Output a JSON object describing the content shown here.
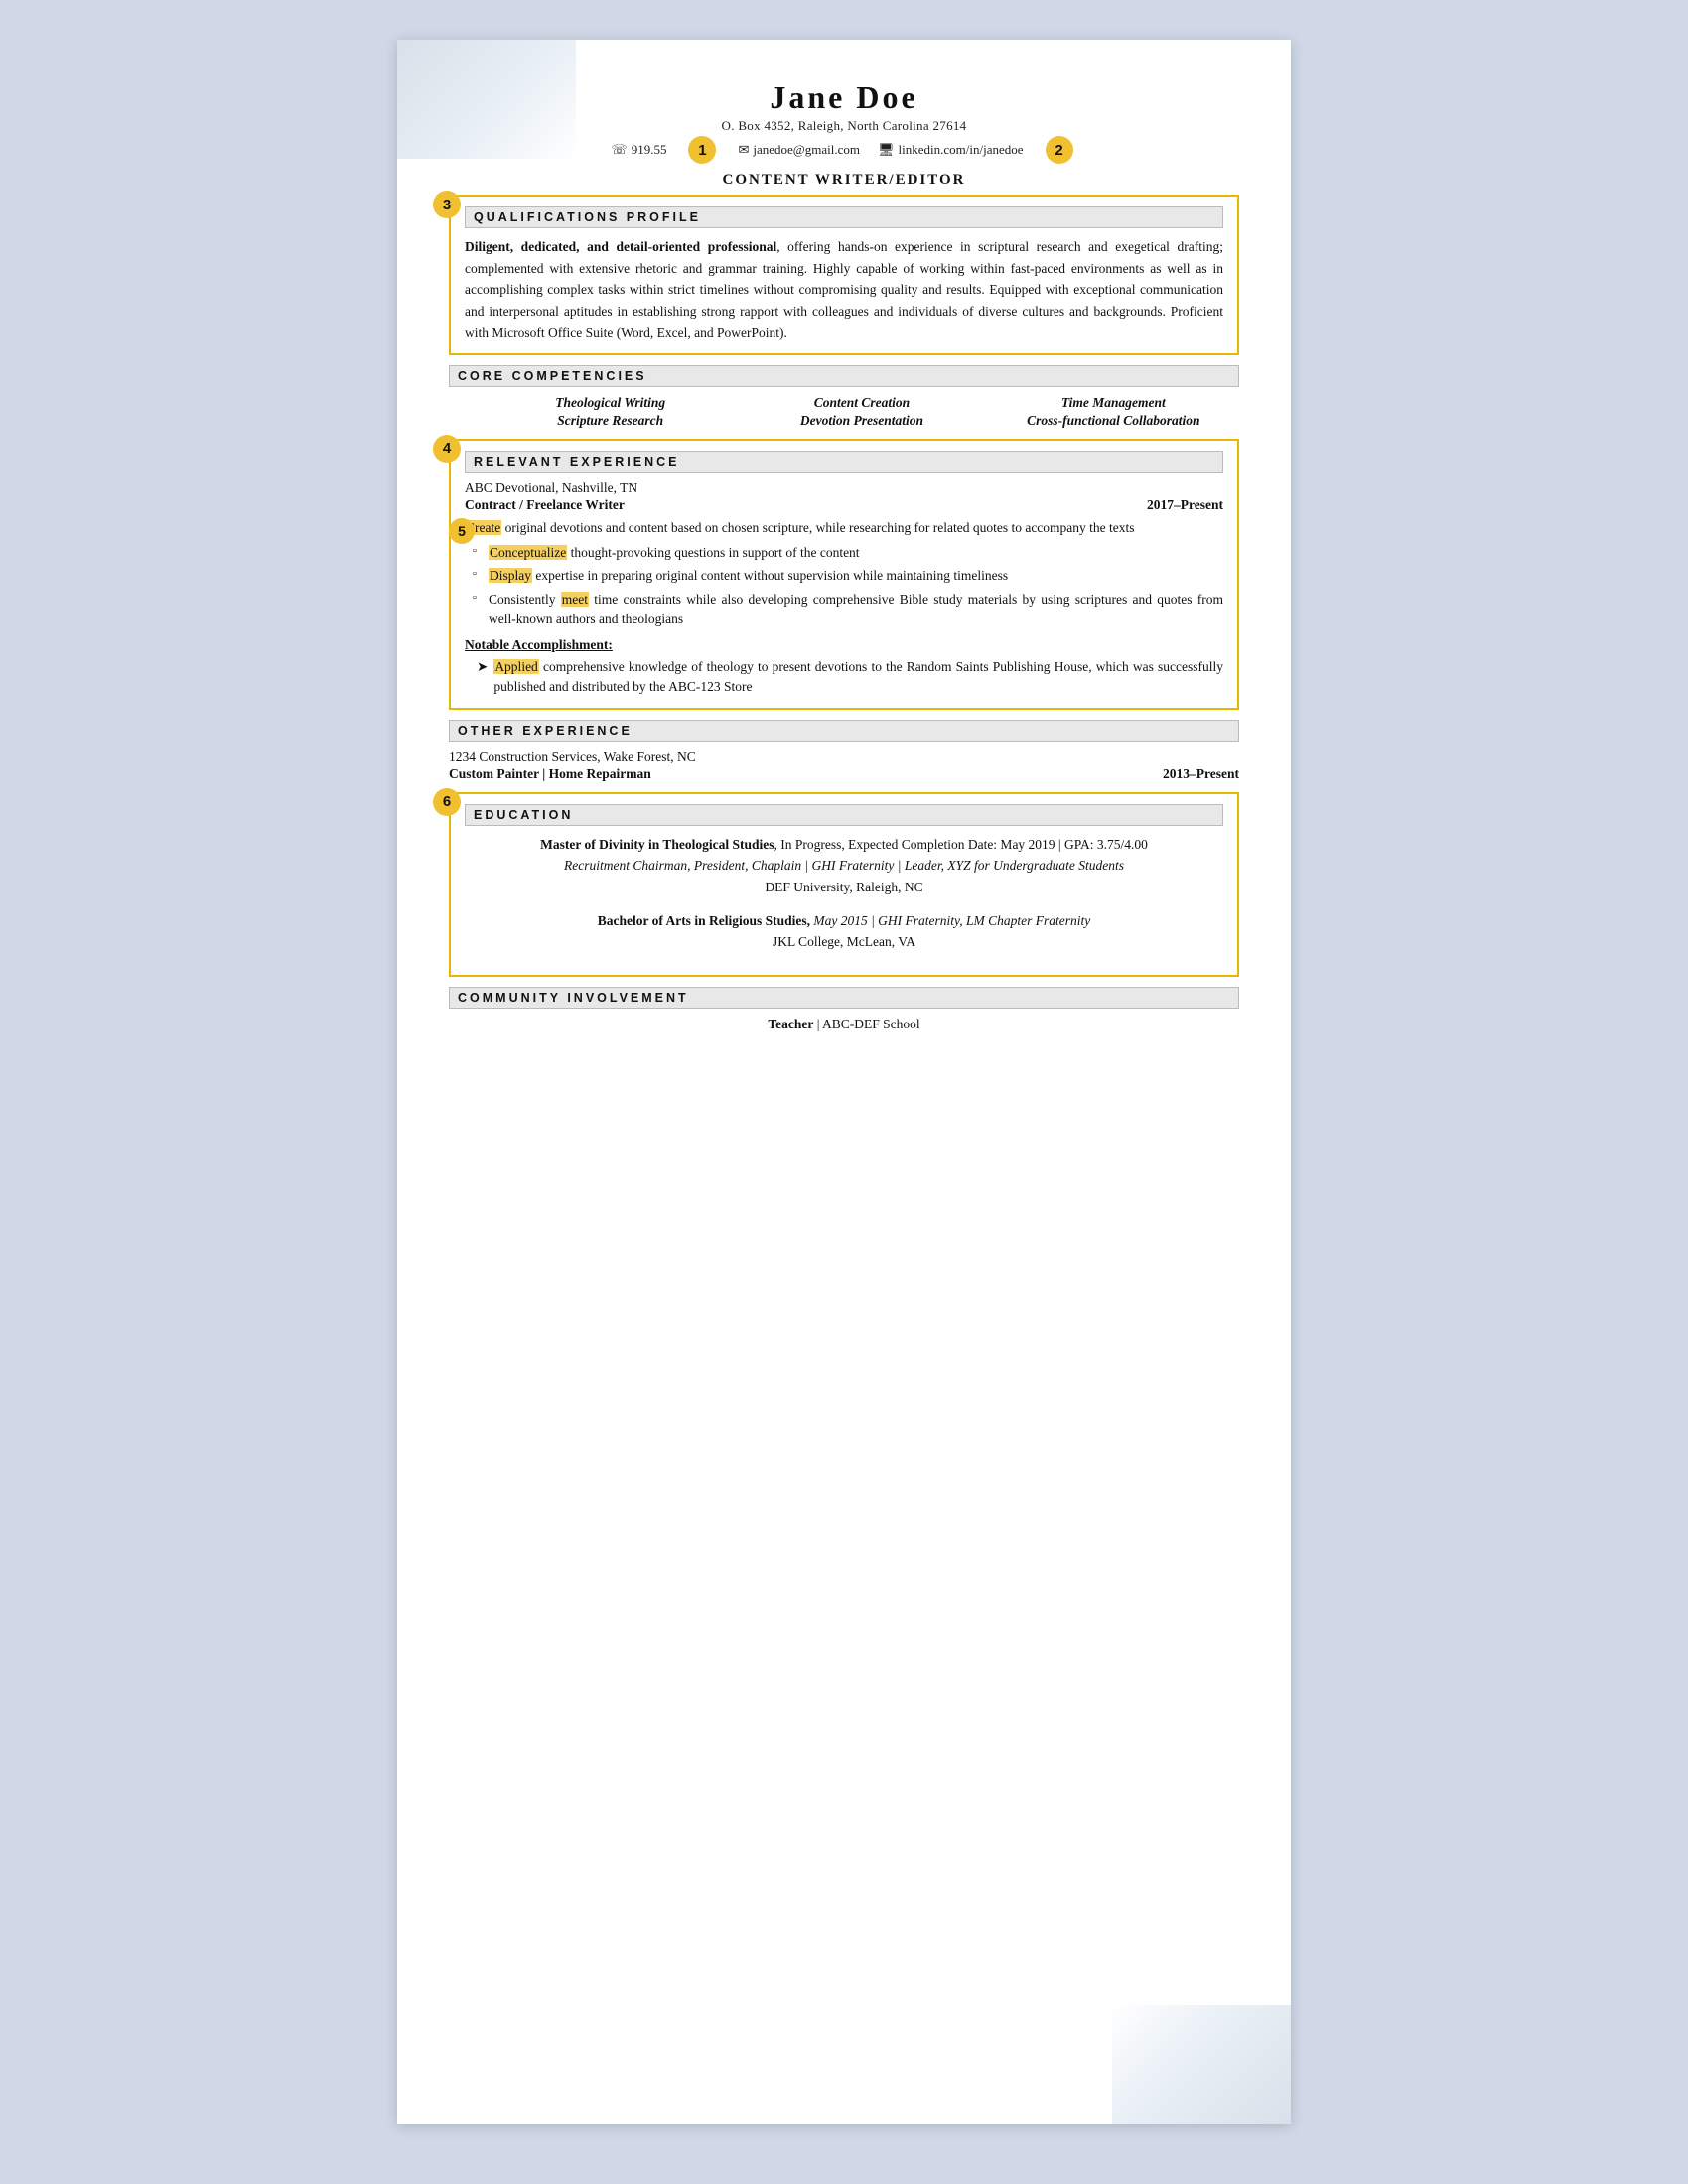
{
  "header": {
    "name": "Jane Doe",
    "address": "O. Box 4352, Raleigh, North Carolina 27614",
    "phone_icon": "☏",
    "phone": "919.55",
    "email_icon": "✉",
    "email": "janedoe@gmail.com",
    "linkedin_icon": "🖥",
    "linkedin": "linkedin.com/in/janedoe",
    "job_title": "Content Writer/Editor"
  },
  "sections": {
    "qualifications_header": "Qualifications Profile",
    "qualifications_text": "Diligent, dedicated, and detail-oriented professional, offering hands-on experience in scriptural research and exegetical drafting; complemented with extensive rhetoric and grammar training. Highly capable of working within fast-paced environments as well as in accomplishing complex tasks within strict timelines without compromising quality and results. Equipped with exceptional communication and interpersonal aptitudes in establishing strong rapport with colleagues and individuals of diverse cultures and backgrounds. Proficient with Microsoft Office Suite (Word, Excel, and PowerPoint).",
    "qualifications_bold": "Diligent, dedicated, and detail-oriented professional",
    "core_header": "Core Competencies",
    "competencies": [
      "Theological Writing",
      "Content Creation",
      "Time Management",
      "Scripture Research",
      "Devotion Presentation",
      "Cross-functional Collaboration"
    ],
    "relevant_header": "Relevant Experience",
    "relevant_company": "ABC Devotional, Nashville, TN",
    "relevant_title": "Contract / Freelance Writer",
    "relevant_dates": "2017–Present",
    "relevant_bullet0": "Create original devotions and content based on chosen scripture, while researching for related quotes to accompany the texts",
    "relevant_bullets": [
      "Conceptualize thought-provoking questions in support of the content",
      "Display expertise in preparing original content without supervision while maintaining timeliness",
      "Consistently meet time constraints while also developing comprehensive Bible study materials by using scriptures and quotes from well-known authors and theologians"
    ],
    "notable_header": "Notable Accomplishment:",
    "notable_text": "Applied comprehensive knowledge of theology to present devotions to the Random Saints Publishing House, which was successfully published and distributed by the ABC-123 Store",
    "other_header": "Other Experience",
    "other_company": "1234 Construction Services, Wake Forest, NC",
    "other_title": "Custom Painter | Home Repairman",
    "other_dates": "2013–Present",
    "education_header": "Education",
    "edu1_degree": "Master of Divinity in Theological Studies",
    "edu1_rest": ", In Progress, Expected Completion Date: May 2019 | GPA: 3.75/4.00",
    "edu1_line2": "Recruitment Chairman, President, Chaplain | GHI Fraternity | Leader, XYZ for Undergraduate Students",
    "edu1_line3": "DEF University, Raleigh, NC",
    "edu2_degree": "Bachelor of Arts in Religious Studies,",
    "edu2_rest": " May 2015 | GHI Fraternity, LM Chapter Fraternity",
    "edu2_line2": "JKL College, McLean, VA",
    "community_header": "Community Involvement",
    "community_line": "Teacher | ABC-DEF School",
    "community_bold": "Teacher",
    "badges": {
      "b1": "1",
      "b2": "2",
      "b3": "3",
      "b4": "4",
      "b5": "5",
      "b6": "6"
    }
  }
}
